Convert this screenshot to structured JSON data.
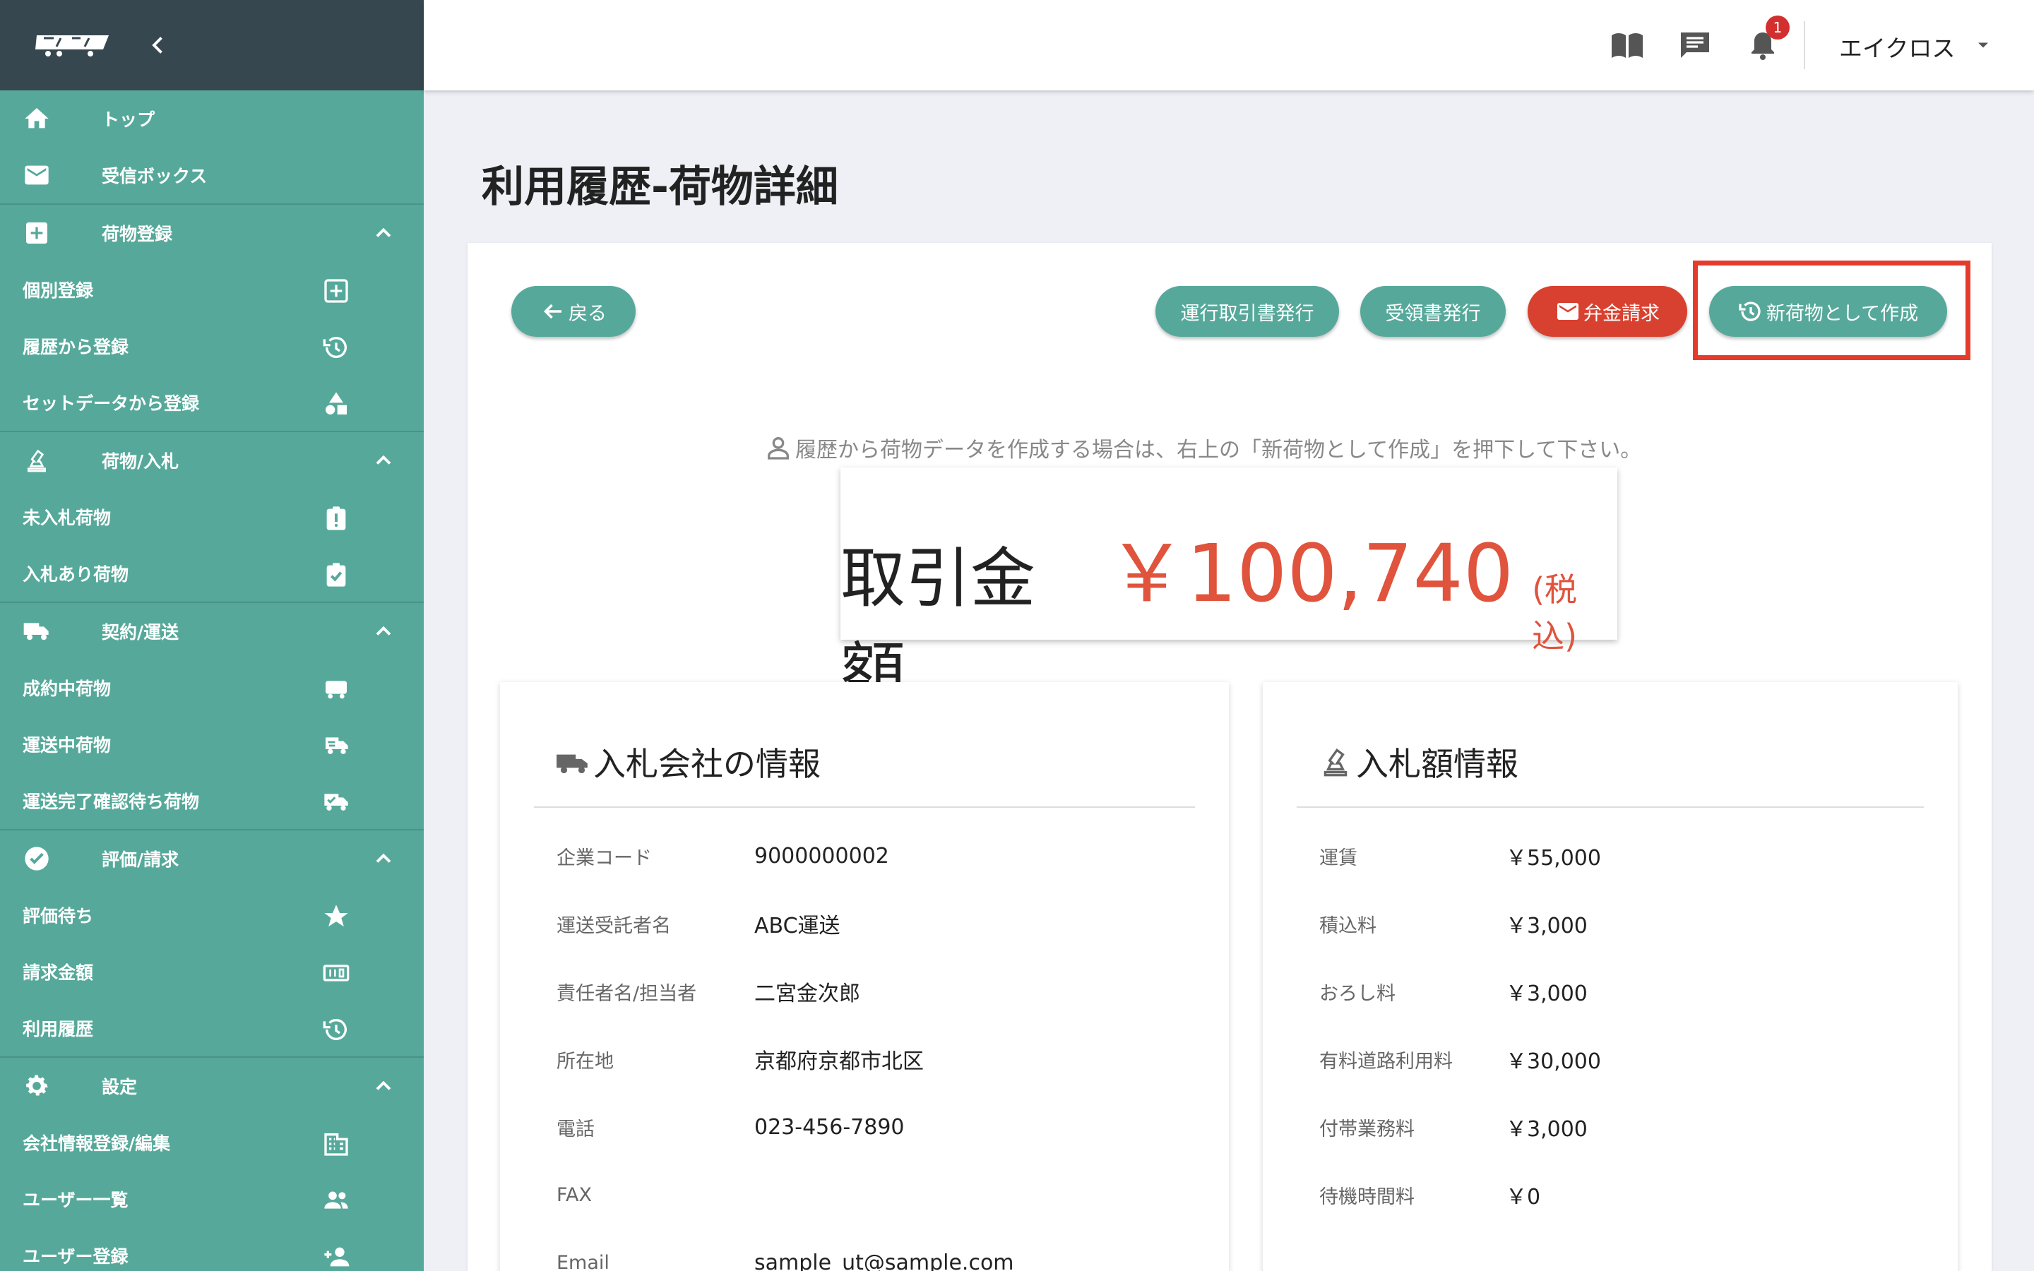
{
  "header": {
    "user_name": "エイクロス",
    "notification_count": "1",
    "icons": [
      "manual-book-icon",
      "chat-icon",
      "bell-icon",
      "dropdown-caret-icon"
    ]
  },
  "sidebar": {
    "items": [
      {
        "type": "section",
        "label": "トップ",
        "icon": "home-icon"
      },
      {
        "type": "section",
        "label": "受信ボックス",
        "icon": "mail-icon"
      },
      {
        "type": "section",
        "label": "荷物登録",
        "icon": "plus-box-icon",
        "expanded": true
      },
      {
        "type": "sub",
        "label": "個別登録",
        "icon": "plus-square-icon"
      },
      {
        "type": "sub",
        "label": "履歴から登録",
        "icon": "history-icon"
      },
      {
        "type": "sub",
        "label": "セットデータから登録",
        "icon": "shapes-icon"
      },
      {
        "type": "section",
        "label": "荷物/入札",
        "icon": "gavel-icon",
        "expanded": true
      },
      {
        "type": "sub",
        "label": "未入札荷物",
        "icon": "clipboard-alert-icon"
      },
      {
        "type": "sub",
        "label": "入札あり荷物",
        "icon": "clipboard-check-icon"
      },
      {
        "type": "section",
        "label": "契約/運送",
        "icon": "truck-icon",
        "expanded": true
      },
      {
        "type": "sub",
        "label": "成約中荷物",
        "icon": "truck-small-icon"
      },
      {
        "type": "sub",
        "label": "運送中荷物",
        "icon": "truck-fast-icon"
      },
      {
        "type": "sub",
        "label": "運送完了確認待ち荷物",
        "icon": "truck-check-icon"
      },
      {
        "type": "section",
        "label": "評価/請求",
        "icon": "check-circle-icon",
        "expanded": true
      },
      {
        "type": "sub",
        "label": "評価待ち",
        "icon": "star-icon"
      },
      {
        "type": "sub",
        "label": "請求金額",
        "icon": "counter-icon"
      },
      {
        "type": "sub",
        "label": "利用履歴",
        "icon": "history-icon"
      },
      {
        "type": "section",
        "label": "設定",
        "icon": "gear-icon",
        "expanded": true
      },
      {
        "type": "sub",
        "label": "会社情報登録/編集",
        "icon": "building-icon"
      },
      {
        "type": "sub",
        "label": "ユーザー一覧",
        "icon": "users-icon"
      },
      {
        "type": "sub",
        "label": "ユーザー登録",
        "icon": "user-add-icon"
      }
    ]
  },
  "page": {
    "title": "利用履歴-荷物詳細"
  },
  "actions": {
    "back": "戻る",
    "issue_transaction_doc": "運行取引書発行",
    "issue_receipt": "受領書発行",
    "request_compensation": "弁金請求",
    "create_as_new": "新荷物として作成"
  },
  "notice": "履歴から荷物データを作成する場合は、右上の「新荷物として作成」を押下して下さい。",
  "amount": {
    "label": "取引金額",
    "value": "￥100,740",
    "tax_note": "(税込)"
  },
  "company_panel": {
    "title": "入札会社の情報",
    "rows": [
      {
        "key": "企業コード",
        "value": "9000000002"
      },
      {
        "key": "運送受託者名",
        "value": "ABC運送"
      },
      {
        "key": "責任者名/担当者",
        "value": "二宮金次郎"
      },
      {
        "key": "所在地",
        "value": "京都府京都市北区"
      },
      {
        "key": "電話",
        "value": "023-456-7890"
      },
      {
        "key": "FAX",
        "value": ""
      },
      {
        "key": "Email",
        "value": "sample_ut@sample.com"
      }
    ]
  },
  "bid_panel": {
    "title": "入札額情報",
    "rows": [
      {
        "key": "運賃",
        "value": "￥55,000"
      },
      {
        "key": "積込料",
        "value": "￥3,000"
      },
      {
        "key": "おろし料",
        "value": "￥3,000"
      },
      {
        "key": "有料道路利用料",
        "value": "￥30,000"
      },
      {
        "key": "付帯業務料",
        "value": "￥3,000"
      },
      {
        "key": "待機時間料",
        "value": "￥0"
      }
    ]
  },
  "colors": {
    "sidebar": "#56a99a",
    "sidebar_header": "#37474f",
    "accent": "#56a99a",
    "danger": "#d8412f",
    "amount": "#e0533c",
    "highlight": "#e53b2c"
  }
}
